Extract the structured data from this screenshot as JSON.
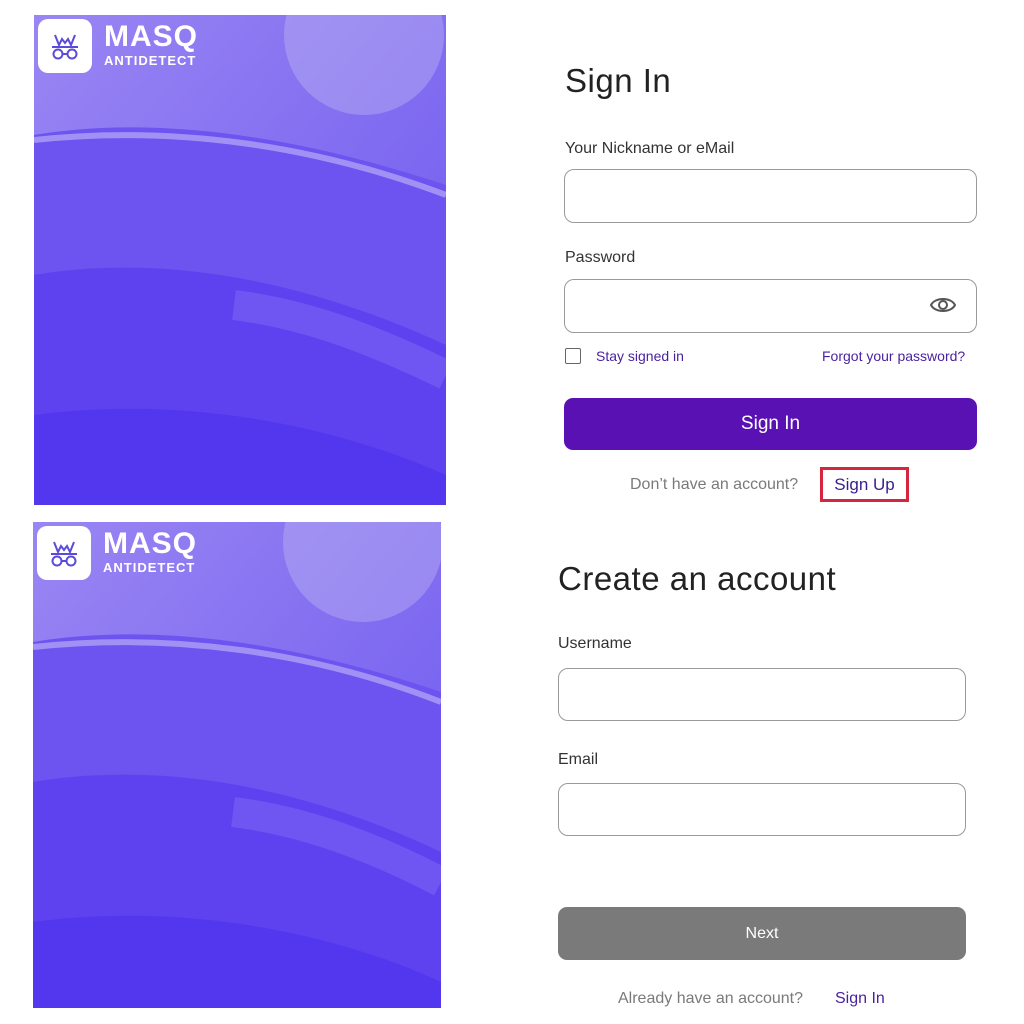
{
  "brand": {
    "name": "MASQ",
    "subtitle": "ANTIDETECT",
    "logo_icon": "incognito-glasses-icon",
    "accent": "#5a11b3"
  },
  "signin": {
    "title": "Sign In",
    "nickname_label": "Your Nickname or eMail",
    "nickname_value": "",
    "password_label": "Password",
    "password_value": "",
    "eye_icon": "eye-icon",
    "stay_signed_in": "Stay signed in",
    "stay_signed_in_checked": false,
    "forgot_password": "Forgot your password?",
    "submit": "Sign In",
    "no_account": "Don’t have an account?",
    "signup_link": "Sign Up",
    "signup_highlight_color": "#d6263f"
  },
  "signup": {
    "title": "Create an account",
    "username_label": "Username",
    "username_value": "",
    "email_label": "Email",
    "email_value": "",
    "next": "Next",
    "next_color": "#7a7a7a",
    "have_account": "Already have an account?",
    "signin_link": "Sign In"
  }
}
